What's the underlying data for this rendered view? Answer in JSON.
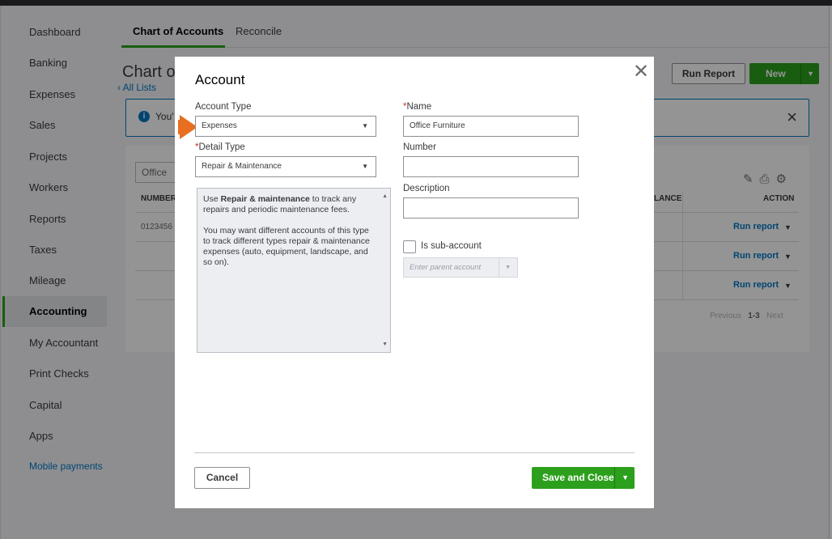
{
  "sidebar": {
    "items": [
      {
        "label": "Dashboard"
      },
      {
        "label": "Banking"
      },
      {
        "label": "Expenses"
      },
      {
        "label": "Sales"
      },
      {
        "label": "Projects"
      },
      {
        "label": "Workers"
      },
      {
        "label": "Reports"
      },
      {
        "label": "Taxes"
      },
      {
        "label": "Mileage"
      },
      {
        "label": "Accounting"
      },
      {
        "label": "My Accountant"
      },
      {
        "label": "Print Checks"
      },
      {
        "label": "Capital"
      },
      {
        "label": "Apps"
      },
      {
        "label": "Mobile payments"
      }
    ]
  },
  "tabs": [
    {
      "label": "Chart of Accounts"
    },
    {
      "label": "Reconcile"
    }
  ],
  "page": {
    "title": "Chart o",
    "all_lists": "All Lists",
    "run_report": "Run Report",
    "new_label": "New",
    "banner_text": "You'",
    "filter_value": "Office",
    "col_number": "NUMBER",
    "col_balance": "LANCE",
    "col_action": "ACTION",
    "row1_number": "0123456",
    "run_report_link": "Run report",
    "pager_prev": "Previous",
    "pager_range": "1-3",
    "pager_next": "Next"
  },
  "modal": {
    "title": "Account",
    "account_type_label": "Account Type",
    "account_type_value": "Expenses",
    "detail_type_label": "Detail Type",
    "detail_type_value": "Repair & Maintenance",
    "name_label": "Name",
    "name_value": "Office Furniture",
    "number_label": "Number",
    "number_value": "",
    "description_label": "Description",
    "description_value": "",
    "desc_pre": "Use ",
    "desc_bold": "Repair & maintenance",
    "desc_post": " to track any repairs and periodic maintenance fees.",
    "desc_para2": "You may want different accounts of this type to track different types repair & maintenance expenses (auto, equipment, landscape, and so on).",
    "subaccount_label": "Is sub-account",
    "parent_placeholder": "Enter parent account",
    "cancel_label": "Cancel",
    "save_label": "Save and Close"
  },
  "colors": {
    "accent_green": "#2ca01c",
    "link_blue": "#0077c5",
    "pointer_orange": "#e86f1f"
  }
}
